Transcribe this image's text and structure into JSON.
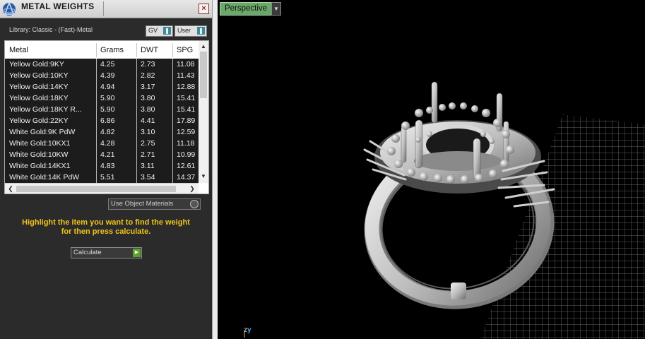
{
  "panel": {
    "title": "METAL WEIGHTS",
    "close_glyph": "×",
    "library_label": "Library: Classic - (Fast)-Metal",
    "gv_combo": "GV",
    "user_combo": "User",
    "use_object_materials": "Use Object Materials",
    "instruction_line1": "Highlight the item you want to find the weight",
    "instruction_line2": "for then press calculate.",
    "calculate_label": "Calculate"
  },
  "table": {
    "headers": [
      "Metal",
      "Grams",
      "DWT",
      "SPG"
    ],
    "rows": [
      [
        "Yellow Gold:9KY",
        "4.25",
        "2.73",
        "11.08"
      ],
      [
        "Yellow Gold:10KY",
        "4.39",
        "2.82",
        "11.43"
      ],
      [
        "Yellow Gold:14KY",
        "4.94",
        "3.17",
        "12.88"
      ],
      [
        "Yellow Gold:18KY",
        "5.90",
        "3.80",
        "15.41"
      ],
      [
        "Yellow Gold:18KY R...",
        "5.90",
        "3.80",
        "15.41"
      ],
      [
        "Yellow Gold:22KY",
        "6.86",
        "4.41",
        "17.89"
      ],
      [
        "White Gold:9K PdW",
        "4.82",
        "3.10",
        "12.59"
      ],
      [
        "White Gold:10KX1",
        "4.28",
        "2.75",
        "11.18"
      ],
      [
        "White Gold:10KW",
        "4.21",
        "2.71",
        "10.99"
      ],
      [
        "White Gold:14KX1",
        "4.83",
        "3.11",
        "12.61"
      ],
      [
        "White Gold:14K PdW",
        "5.51",
        "3.54",
        "14.37"
      ]
    ]
  },
  "viewport": {
    "view_label": "Perspective",
    "axis_z": "z",
    "axis_y": "y"
  },
  "colors": {
    "accent_yellow": "#f0c419",
    "view_tab_green": "#6aa86a",
    "panel_bg": "#2b2b2b"
  },
  "icons": {
    "app_logo": "app-logo-icon",
    "close": "close-icon",
    "dropdown": "chevron-down-icon",
    "play": "play-icon"
  }
}
